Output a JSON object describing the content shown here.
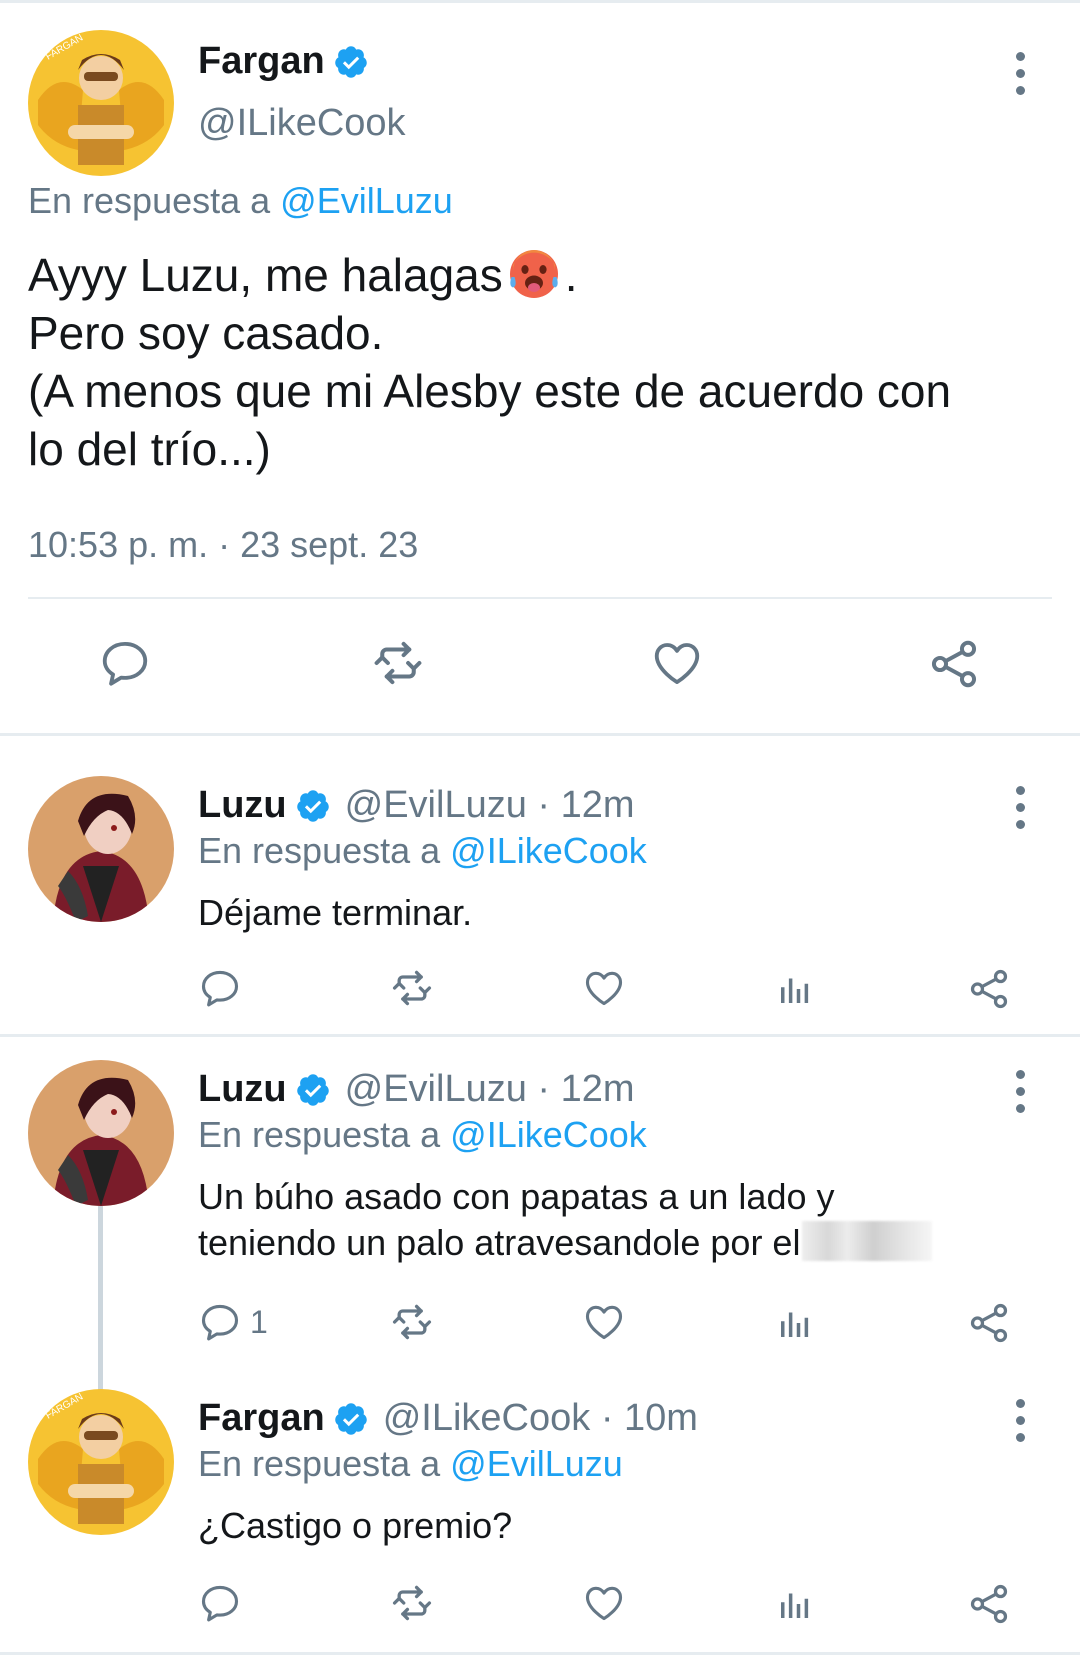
{
  "main_tweet": {
    "author_name": "Fargan",
    "author_handle": "@ILikeCook",
    "reply_prefix": "En respuesta a",
    "reply_to": "@EvilLuzu",
    "text_lines": [
      "Ayyy Luzu, me halagas",
      ".",
      "Pero soy casado.",
      "(A menos que mi Alesby este de acuerdo con",
      "lo del trío...)"
    ],
    "emoji": "hot-face-emoji",
    "timestamp": "10:53 p. m. · 23 sept. 23",
    "actions": [
      "reply-icon",
      "retweet-icon",
      "like-icon",
      "share-icon"
    ]
  },
  "replies": [
    {
      "author_name": "Luzu",
      "author_handle": "@EvilLuzu · 12m",
      "reply_prefix": "En respuesta a",
      "reply_to": "@ILikeCook",
      "text_lines": [
        "Déjame terminar."
      ],
      "reply_count": ""
    },
    {
      "author_name": "Luzu",
      "author_handle": "@EvilLuzu · 12m",
      "reply_prefix": "En respuesta a",
      "reply_to": "@ILikeCook",
      "text_lines": [
        "Un búho asado con papatas a un lado y",
        "teniendo un palo atravesandole por el"
      ],
      "reply_count": "1"
    },
    {
      "author_name": "Fargan",
      "author_handle": "@ILikeCook · 10m",
      "reply_prefix": "En respuesta a",
      "reply_to": "@EvilLuzu",
      "text_lines": [
        "¿Castigo o premio?"
      ],
      "reply_count": ""
    }
  ],
  "colors": {
    "link": "#1da1f2",
    "secondary_text": "#657786",
    "divider": "#e6ecf0",
    "verified": "#1da1f2"
  }
}
